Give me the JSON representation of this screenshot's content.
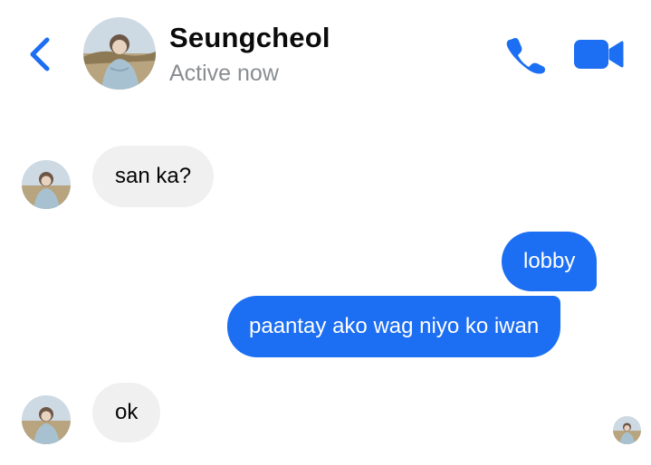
{
  "header": {
    "contact_name": "Seungcheol",
    "status": "Active now",
    "back_icon": "chevron-left-icon",
    "call_icon": "phone-icon",
    "video_icon": "video-camera-icon"
  },
  "messages": [
    {
      "direction": "incoming",
      "text": "san ka?"
    },
    {
      "direction": "outgoing",
      "text": "lobby"
    },
    {
      "direction": "outgoing",
      "text": "paantay ako wag niyo ko iwan"
    },
    {
      "direction": "incoming",
      "text": "ok"
    }
  ],
  "colors": {
    "accent": "#1c6ef2",
    "incoming_bubble": "#f0f0f0",
    "status_text": "#8a8d91"
  }
}
